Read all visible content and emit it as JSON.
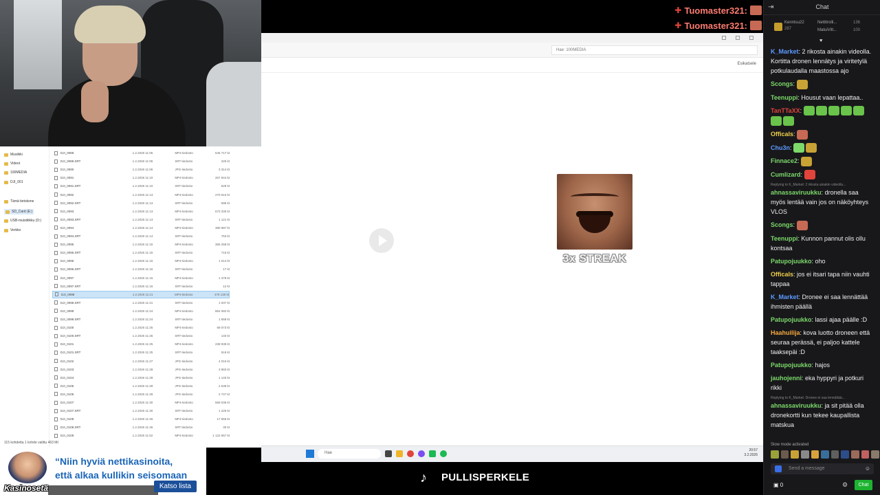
{
  "alerts": [
    {
      "name": "Tuomaster321:"
    },
    {
      "name": "Tuomaster321:"
    }
  ],
  "screen": {
    "search_placeholder": "Hae: 100MEDIA",
    "preview_label": "Esikatsele",
    "streak_label": "3x STREAK",
    "taskbar_search": "Hae",
    "clock_time": "20:57",
    "clock_date": "3.2.2026"
  },
  "explorer": {
    "nav": [
      "Musiikki",
      "Videot",
      "100MEDIA",
      "DJI_001",
      "Tämä tietokone",
      "SD_Card (E:)",
      "USB-muistitikku (D:)",
      "Verkko"
    ],
    "files": [
      {
        "name": "DJI_0089",
        "date": "1.2.2026 11:06",
        "type": "MP4-tiedosto",
        "size": "545 717 kt"
      },
      {
        "name": "DJI_0089.SRT",
        "date": "1.2.2026 11:06",
        "type": "SRT-tiedosto",
        "size": "225 kt"
      },
      {
        "name": "DJI_0090",
        "date": "1.2.2026 11:06",
        "type": "JPG-tiedosto",
        "size": "3 314 kt"
      },
      {
        "name": "DJI_0091",
        "date": "1.2.2026 11:10",
        "type": "MP4-tiedosto",
        "size": "267 844 kt"
      },
      {
        "name": "DJI_0091.SRT",
        "date": "1.2.2026 11:10",
        "type": "SRT-tiedosto",
        "size": "529 kt"
      },
      {
        "name": "DJI_0092",
        "date": "1.2.2026 11:13",
        "type": "MP4-tiedosto",
        "size": "270 610 kt"
      },
      {
        "name": "DJI_0092.SRT",
        "date": "1.2.2026 11:13",
        "type": "SRT-tiedosto",
        "size": "595 kt"
      },
      {
        "name": "DJI_0093",
        "date": "1.2.2026 11:13",
        "type": "MP4-tiedosto",
        "size": "573 330 kt"
      },
      {
        "name": "DJI_0093.SRT",
        "date": "1.2.2026 11:13",
        "type": "SRT-tiedosto",
        "size": "1 121 kt"
      },
      {
        "name": "DJI_0094",
        "date": "1.2.2026 11:14",
        "type": "MP4-tiedosto",
        "size": "380 987 kt"
      },
      {
        "name": "DJI_0094.SRT",
        "date": "1.2.2026 11:14",
        "type": "SRT-tiedosto",
        "size": "753 kt"
      },
      {
        "name": "DJI_0095",
        "date": "1.2.2026 11:15",
        "type": "MP4-tiedosto",
        "size": "365 258 kt"
      },
      {
        "name": "DJI_0095.SRT",
        "date": "1.2.2026 11:15",
        "type": "SRT-tiedosto",
        "size": "715 kt"
      },
      {
        "name": "DJI_0096",
        "date": "1.2.2026 11:16",
        "type": "MP4-tiedosto",
        "size": "1 014 kt"
      },
      {
        "name": "DJI_0096.SRT",
        "date": "1.2.2026 11:16",
        "type": "SRT-tiedosto",
        "size": "17 kt"
      },
      {
        "name": "DJI_0097",
        "date": "1.2.2026 11:16",
        "type": "MP4-tiedosto",
        "size": "1 378 kt"
      },
      {
        "name": "DJI_0097.SRT",
        "date": "1.2.2026 11:16",
        "type": "SRT-tiedosto",
        "size": "12 kt"
      },
      {
        "name": "DJI_0098",
        "date": "1.2.2026 11:21",
        "type": "MP4-tiedosto",
        "size": "475 130 kt",
        "selected": true
      },
      {
        "name": "DJI_0098.SRT",
        "date": "1.2.2026 11:21",
        "type": "SRT-tiedosto",
        "size": "1 037 kt"
      },
      {
        "name": "DJI_0099",
        "date": "1.2.2026 11:24",
        "type": "MP4-tiedosto",
        "size": "864 082 kt"
      },
      {
        "name": "DJI_0099.SRT",
        "date": "1.2.2026 11:24",
        "type": "SRT-tiedosto",
        "size": "1 658 kt"
      },
      {
        "name": "DJI_0100",
        "date": "1.2.2026 11:25",
        "type": "MP4-tiedosto",
        "size": "69 073 kt"
      },
      {
        "name": "DJI_0100.SRT",
        "date": "1.2.2026 11:25",
        "type": "SRT-tiedosto",
        "size": "140 kt"
      },
      {
        "name": "DJI_0101",
        "date": "1.2.2026 11:25",
        "type": "MP4-tiedosto",
        "size": "238 938 kt"
      },
      {
        "name": "DJI_0101.SRT",
        "date": "1.2.2026 11:25",
        "type": "SRT-tiedosto",
        "size": "516 kt"
      },
      {
        "name": "DJI_0102",
        "date": "1.2.2026 11:27",
        "type": "JPG-tiedosto",
        "size": "4 016 kt"
      },
      {
        "name": "DJI_0103",
        "date": "1.2.2026 11:28",
        "type": "JPG-tiedosto",
        "size": "3 983 kt"
      },
      {
        "name": "DJI_0104",
        "date": "1.2.2026 11:28",
        "type": "JPG-tiedosto",
        "size": "1 140 kt"
      },
      {
        "name": "DJI_0105",
        "date": "1.2.2026 11:28",
        "type": "JPG-tiedosto",
        "size": "2 639 kt"
      },
      {
        "name": "DJI_0106",
        "date": "1.2.2026 11:28",
        "type": "JPG-tiedosto",
        "size": "2 747 kt"
      },
      {
        "name": "DJI_0107",
        "date": "1.2.2026 11:30",
        "type": "MP4-tiedosto",
        "size": "559 036 kt"
      },
      {
        "name": "DJI_0107.SRT",
        "date": "1.2.2026 11:30",
        "type": "SRT-tiedosto",
        "size": "1 225 kt"
      },
      {
        "name": "DJI_0108",
        "date": "1.2.2026 11:46",
        "type": "MP4-tiedosto",
        "size": "17 666 kt"
      },
      {
        "name": "DJI_0108.SRT",
        "date": "1.2.2026 11:46",
        "type": "SRT-tiedosto",
        "size": "30 kt"
      },
      {
        "name": "DJI_0109",
        "date": "1.2.2026 11:52",
        "type": "MP4-tiedosto",
        "size": "1 122 557 kt"
      }
    ],
    "status": "115 kohdetta   1 kohde valittu  463 Mt"
  },
  "ad": {
    "brand": "Kasinosetä",
    "line1": "“Niin hyviä nettikasinoita,",
    "line2": "että alkaa kullikin seisomaan",
    "cta": "Katso lista"
  },
  "handle": "PULLISPERKELE",
  "chat": {
    "title": "Chat",
    "leader1_name": "Kenntsu22",
    "leader1_pts": "287",
    "leader2_name": "Nettitrolli...",
    "leader2_pts": "136",
    "leader3_name": "MatuiVitt...",
    "leader3_pts": "100",
    "messages": [
      {
        "user": "K_Market",
        "color": "#5c9bff",
        "text": "2 rikosta ainakin videolla. Kortitta dronen lennätys ja viritetylä potkulaudalla maastossa ajo"
      },
      {
        "user": "Scongs",
        "color": "#7cd96a",
        "text": ""
      },
      {
        "user": "Teenuppi",
        "color": "#7cd96a",
        "text": "Housut vaan lepattaa.."
      },
      {
        "user": "TanTTaXX",
        "color": "#e0443a",
        "text": ""
      },
      {
        "user": "Officals",
        "color": "#f1d04b",
        "text": ""
      },
      {
        "user": "Chu3n",
        "color": "#5c9bff",
        "text": ""
      },
      {
        "user": "Finnace2",
        "color": "#7cd96a",
        "text": ""
      },
      {
        "user": "Cumlizard",
        "color": "#7cd96a",
        "text": ""
      },
      {
        "reply": "Replying to K_Market: 2 rikosta ainakin videolla...",
        "user": "ahnassaviruukku",
        "color": "#7cd96a",
        "text": "dronella saa myös lentää vain jos on näköyhteys VLOS"
      },
      {
        "user": "Scongs",
        "color": "#7cd96a",
        "text": ""
      },
      {
        "user": "Teenuppi",
        "color": "#7cd96a",
        "text": "Kunnon pannut olis ollu kontsaa"
      },
      {
        "user": "Patupojuukko",
        "color": "#7cd96a",
        "text": "oho"
      },
      {
        "user": "Officals",
        "color": "#f1d04b",
        "text": "jos ei itsari tapa niin vauhti tappaa"
      },
      {
        "user": "K_Market",
        "color": "#5c9bff",
        "text": "Dronee ei saa lennättää ihmisten päällä"
      },
      {
        "user": "Patupojuukko",
        "color": "#7cd96a",
        "text": "lassi ajaa päälle :D"
      },
      {
        "user": "Haahuilija",
        "color": "#f4a93e",
        "text": "kova luotto droneen että seuraa perässä, ei paljoo kattele taaksepäi :D"
      },
      {
        "user": "Patupojuukko",
        "color": "#7cd96a",
        "text": "hajos"
      },
      {
        "user": "jauhojenni",
        "color": "#7cd96a",
        "text": "eka hyppyri ja potkuri rikki"
      },
      {
        "reply": "Replying to K_Market: Dronee ei saa lennättää...",
        "user": "ahnassaviruukku",
        "color": "#7cd96a",
        "text": "ja sit pitää olla dronekortti kun tekee kaupallista matskua"
      }
    ],
    "slow_mode": "Slow mode activated",
    "input_placeholder": "Send a message",
    "points": "0",
    "chat_button": "Chat"
  }
}
